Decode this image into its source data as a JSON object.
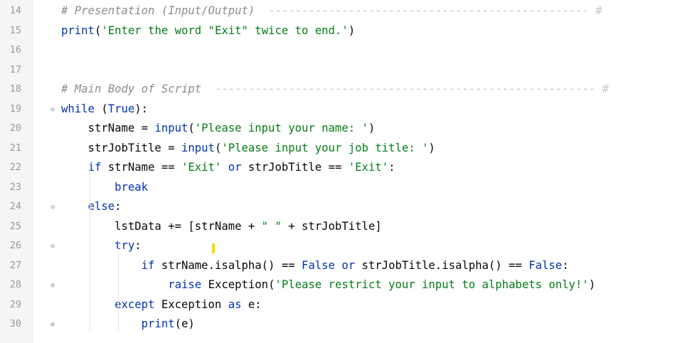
{
  "lines": [
    {
      "n": "14",
      "tokens": [
        {
          "t": "# Presentation (Input/Output)",
          "c": "cm"
        },
        {
          "t": "  ------------------------------------------------ #",
          "c": "sep"
        }
      ]
    },
    {
      "n": "15",
      "tokens": [
        {
          "t": "print",
          "c": "kw"
        },
        {
          "t": "(",
          "c": "plain"
        },
        {
          "t": "'Enter the word \"Exit\" twice to end.'",
          "c": "str"
        },
        {
          "t": ")",
          "c": "plain"
        }
      ]
    },
    {
      "n": "16",
      "tokens": []
    },
    {
      "n": "17",
      "tokens": []
    },
    {
      "n": "18",
      "tokens": [
        {
          "t": "# Main Body of Script",
          "c": "cm"
        },
        {
          "t": "  --------------------------------------------------------- #",
          "c": "sep"
        }
      ]
    },
    {
      "n": "19",
      "tokens": [
        {
          "t": "while ",
          "c": "kw"
        },
        {
          "t": "(",
          "c": "plain"
        },
        {
          "t": "True",
          "c": "kw"
        },
        {
          "t": "):",
          "c": "plain"
        }
      ]
    },
    {
      "n": "20",
      "tokens": [
        {
          "t": "    strName = ",
          "c": "plain"
        },
        {
          "t": "input",
          "c": "kw"
        },
        {
          "t": "(",
          "c": "plain"
        },
        {
          "t": "'Please input your name: '",
          "c": "str"
        },
        {
          "t": ")",
          "c": "plain"
        }
      ]
    },
    {
      "n": "21",
      "tokens": [
        {
          "t": "    strJobTitle = ",
          "c": "plain"
        },
        {
          "t": "input",
          "c": "kw"
        },
        {
          "t": "(",
          "c": "plain"
        },
        {
          "t": "'Please input your job title: '",
          "c": "str"
        },
        {
          "t": ")",
          "c": "plain"
        }
      ]
    },
    {
      "n": "22",
      "tokens": [
        {
          "t": "    ",
          "c": "plain"
        },
        {
          "t": "if ",
          "c": "kw"
        },
        {
          "t": "strName == ",
          "c": "plain"
        },
        {
          "t": "'Exit'",
          "c": "str"
        },
        {
          "t": " ",
          "c": "plain"
        },
        {
          "t": "or ",
          "c": "kw"
        },
        {
          "t": "strJobTitle == ",
          "c": "plain"
        },
        {
          "t": "'Exit'",
          "c": "str"
        },
        {
          "t": ":",
          "c": "plain"
        }
      ]
    },
    {
      "n": "23",
      "tokens": [
        {
          "t": "        ",
          "c": "plain"
        },
        {
          "t": "break",
          "c": "kw"
        }
      ]
    },
    {
      "n": "24",
      "tokens": [
        {
          "t": "    ",
          "c": "plain"
        },
        {
          "t": "else",
          "c": "kw"
        },
        {
          "t": ":",
          "c": "plain"
        }
      ]
    },
    {
      "n": "25",
      "tokens": [
        {
          "t": "        lstData += [strName + ",
          "c": "plain"
        },
        {
          "t": "\" \"",
          "c": "str"
        },
        {
          "t": " + strJobTitle]",
          "c": "plain"
        }
      ]
    },
    {
      "n": "26",
      "tokens": [
        {
          "t": "        ",
          "c": "plain"
        },
        {
          "t": "try",
          "c": "kw"
        },
        {
          "t": ":",
          "c": "plain"
        }
      ]
    },
    {
      "n": "27",
      "tokens": [
        {
          "t": "            ",
          "c": "plain"
        },
        {
          "t": "if ",
          "c": "kw"
        },
        {
          "t": "strName.isalpha() == ",
          "c": "plain"
        },
        {
          "t": "False ",
          "c": "kw"
        },
        {
          "t": "or ",
          "c": "kw"
        },
        {
          "t": "strJobTitle.isalpha() == ",
          "c": "plain"
        },
        {
          "t": "False",
          "c": "kw"
        },
        {
          "t": ":",
          "c": "plain"
        }
      ]
    },
    {
      "n": "28",
      "tokens": [
        {
          "t": "                ",
          "c": "plain"
        },
        {
          "t": "raise ",
          "c": "kw"
        },
        {
          "t": "Exception",
          "c": "plain"
        },
        {
          "t": "(",
          "c": "plain"
        },
        {
          "t": "'Please restrict your input to alphabets only!'",
          "c": "str"
        },
        {
          "t": ")",
          "c": "plain"
        }
      ]
    },
    {
      "n": "29",
      "tokens": [
        {
          "t": "        ",
          "c": "plain"
        },
        {
          "t": "except ",
          "c": "kw"
        },
        {
          "t": "Exception ",
          "c": "plain"
        },
        {
          "t": "as ",
          "c": "kw"
        },
        {
          "t": "e:",
          "c": "plain"
        }
      ]
    },
    {
      "n": "30",
      "tokens": [
        {
          "t": "            ",
          "c": "plain"
        },
        {
          "t": "print",
          "c": "kw"
        },
        {
          "t": "(e)",
          "c": "plain"
        }
      ]
    }
  ],
  "fold_markers": [
    {
      "line_index": 5,
      "glyph": "⊖"
    },
    {
      "line_index": 10,
      "glyph": "⊖"
    },
    {
      "line_index": 12,
      "glyph": "⊖"
    },
    {
      "line_index": 14,
      "glyph": "⊕"
    },
    {
      "line_index": 16,
      "glyph": "⊕"
    }
  ],
  "colors": {
    "keyword": "#0033b3",
    "string": "#067d17",
    "comment": "#8c8c8c",
    "caret": "#f4dd00"
  }
}
